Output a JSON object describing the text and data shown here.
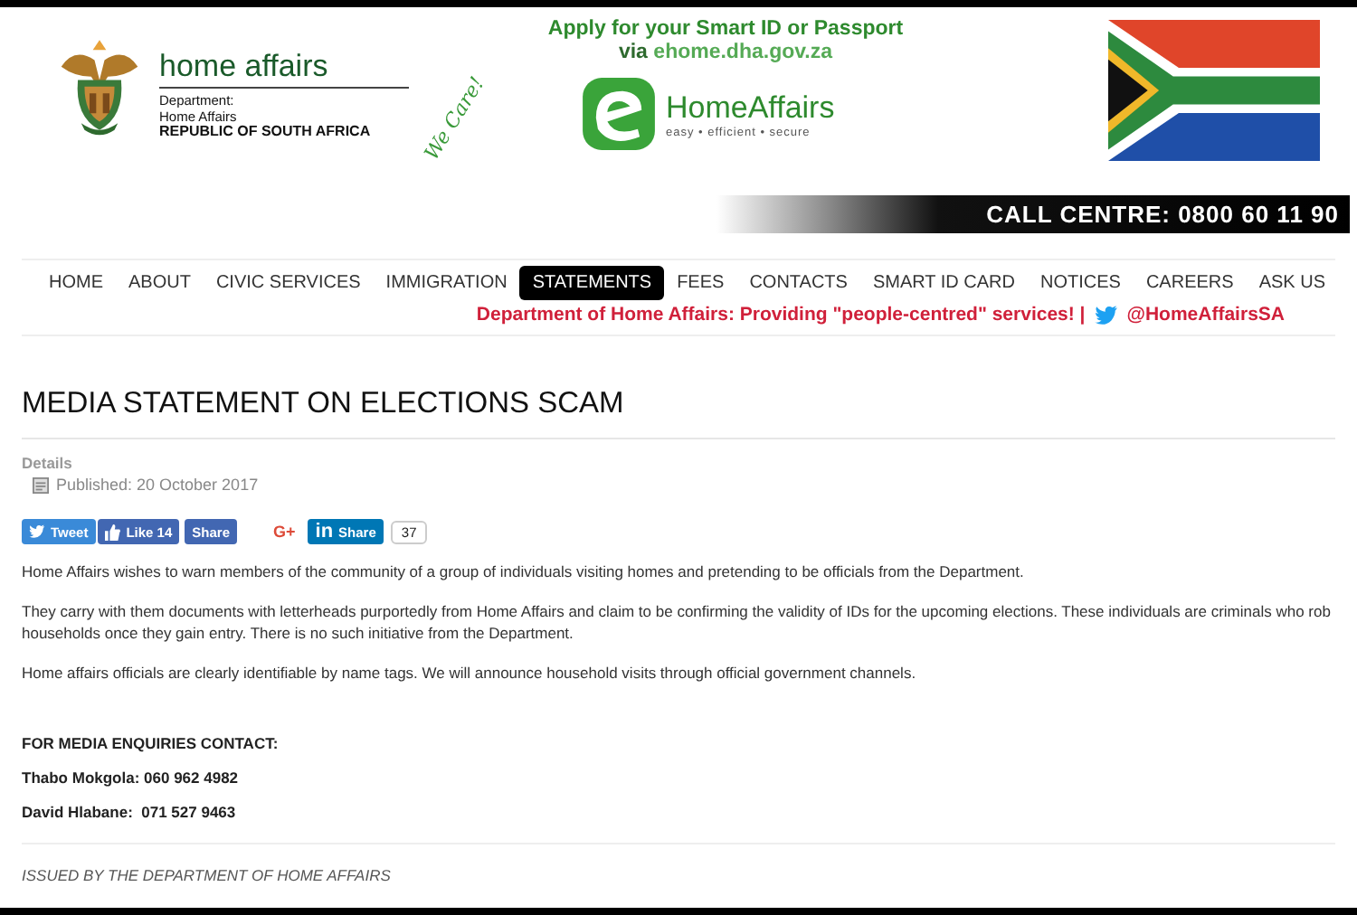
{
  "header": {
    "agency": {
      "name": "home affairs",
      "line1": "Department:",
      "line2": "Home Affairs",
      "line3": "REPUBLIC OF SOUTH AFRICA"
    },
    "slogan": "We Care!",
    "promo": {
      "line1": "Apply for your Smart ID or Passport",
      "prefix": "via",
      "link": "ehome.dha.gov.za"
    },
    "ehome": {
      "name": "HomeAffairs",
      "tagline": "easy • efficient • secure"
    },
    "call_centre": "CALL CENTRE:  0800 60 11 90"
  },
  "nav": [
    {
      "label": "HOME",
      "selected": false
    },
    {
      "label": "ABOUT",
      "selected": false
    },
    {
      "label": "CIVIC SERVICES",
      "selected": false
    },
    {
      "label": "IMMIGRATION",
      "selected": false
    },
    {
      "label": "STATEMENTS",
      "selected": true
    },
    {
      "label": "FEES",
      "selected": false
    },
    {
      "label": "CONTACTS",
      "selected": false
    },
    {
      "label": "SMART ID CARD",
      "selected": false
    },
    {
      "label": "NOTICES",
      "selected": false
    },
    {
      "label": "CAREERS",
      "selected": false
    },
    {
      "label": "ASK US",
      "selected": false
    }
  ],
  "tagline": {
    "text": "Department of Home Affairs: Providing \"people-centred\" services! |",
    "handle": "@HomeAffairsSA"
  },
  "article": {
    "title": "MEDIA STATEMENT ON ELECTIONS SCAM",
    "details_label": "Details",
    "published": "Published: 20 October 2017",
    "share": [
      {
        "kind": "tweet",
        "label": "Tweet"
      },
      {
        "kind": "like",
        "label": "Like 14"
      },
      {
        "kind": "share",
        "label": "Share"
      },
      {
        "kind": "gplus",
        "label": "G+"
      },
      {
        "kind": "linkedin",
        "logo": "in",
        "label": "Share"
      }
    ],
    "share_count": "37",
    "paragraphs": [
      "Home Affairs wishes to warn members of the community of a group of individuals visiting homes and pretending to be officials from the Department.",
      "They carry with them documents with letterheads purportedly from Home Affairs and claim to be confirming the validity of IDs for the upcoming elections. These individuals are criminals who rob households once they gain entry. There is no such initiative from the Department.",
      "Home affairs officials are clearly identifiable by name tags. We will announce household visits through official government channels."
    ],
    "contact_heading": "FOR MEDIA ENQUIRIES CONTACT:",
    "contacts": [
      "Thabo Mokgola: 060 962 4982",
      "David Hlabane:  071 527 9463"
    ],
    "footer": "ISSUED BY THE DEPARTMENT OF HOME AFFAIRS"
  }
}
